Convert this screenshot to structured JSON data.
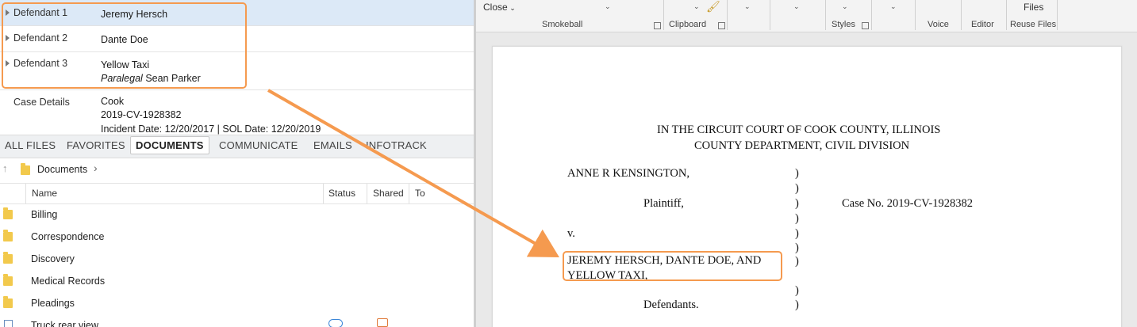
{
  "matter": {
    "defendants": [
      {
        "label": "Defendant 1",
        "name": "Jeremy Hersch"
      },
      {
        "label": "Defendant 2",
        "name": "Dante Doe"
      },
      {
        "label": "Defendant 3",
        "name": "Yellow Taxi",
        "sub_role": "Paralegal",
        "sub_name": "Sean Parker"
      }
    ],
    "case_details": {
      "label": "Case Details",
      "county": "Cook",
      "case_no": "2019-CV-1928382",
      "dates": "Incident Date: 12/20/2017 | SOL Date: 12/20/2019"
    }
  },
  "tabs": [
    "ALL FILES",
    "FAVORITES",
    "DOCUMENTS",
    "COMMUNICATE",
    "EMAILS",
    "INFOTRACK"
  ],
  "active_tab": "DOCUMENTS",
  "breadcrumb": {
    "folder": "Documents"
  },
  "columns": {
    "name": "Name",
    "status": "Status",
    "shared": "Shared",
    "to": "To"
  },
  "folders": [
    "Billing",
    "Correspondence",
    "Discovery",
    "Medical Records",
    "Pleadings"
  ],
  "last_file": "Truck rear view",
  "ribbon": {
    "close": "Close",
    "files": "Files",
    "groups": {
      "smokeball": "Smokeball",
      "clipboard": "Clipboard",
      "styles": "Styles",
      "voice": "Voice",
      "editor": "Editor",
      "reuse_files": "Reuse Files"
    }
  },
  "document": {
    "court_line1": "IN THE CIRCUIT COURT OF COOK COUNTY, ILLINOIS",
    "court_line2": "COUNTY DEPARTMENT, CIVIL DIVISION",
    "plaintiff_name": "ANNE R KENSINGTON,",
    "plaintiff_role": "Plaintiff,",
    "case_no": "Case No. 2019-CV-1928382",
    "versus": "v.",
    "defendants_line1": "JEREMY HERSCH, DANTE DOE, AND",
    "defendants_line2": "YELLOW TAXI,",
    "defendants_role": "Defendants.",
    "paren": ")"
  },
  "colors": {
    "highlight": "#f59a4f",
    "folder": "#f2c94c",
    "selected_row": "#dce9f7"
  }
}
